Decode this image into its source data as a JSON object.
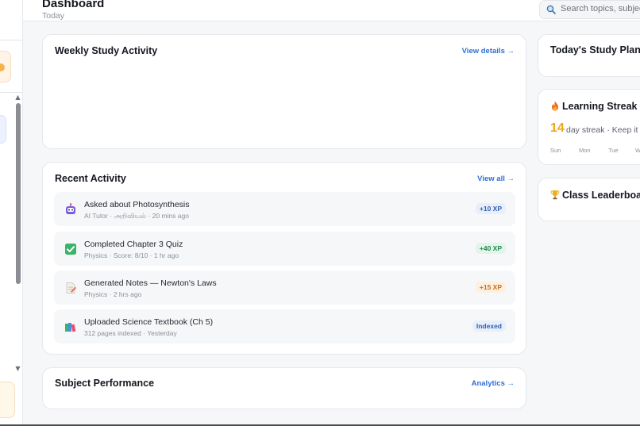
{
  "header": {
    "title": "Dashboard",
    "subtitle": "Today",
    "search_placeholder": "Search topics, subject"
  },
  "weekly": {
    "title": "Weekly Study Activity",
    "link": "View details →"
  },
  "recent": {
    "title": "Recent Activity",
    "link": "View all →",
    "items": [
      {
        "title": "Asked about Photosynthesis",
        "meta": "AI Tutor · அறிவியல் · 20 mins ago",
        "badge": "+10 XP",
        "icon": "robot-icon"
      },
      {
        "title": "Completed Chapter 3 Quiz",
        "meta": "Physics · Score: 8/10 · 1 hr ago",
        "badge": "+40 XP",
        "icon": "checkmark-icon"
      },
      {
        "title": "Generated Notes — Newton's Laws",
        "meta": "Physics · 2 hrs ago",
        "badge": "+15 XP",
        "icon": "memo-icon"
      },
      {
        "title": "Uploaded Science Textbook (Ch 5)",
        "meta": "312 pages indexed · Yesterday",
        "badge": "Indexed",
        "icon": "books-icon"
      }
    ]
  },
  "subject": {
    "title": "Subject Performance",
    "link": "Analytics →"
  },
  "plan": {
    "title": "Today's Study Plan"
  },
  "streak": {
    "title": "Learning Streak",
    "icon": "fire-icon",
    "count": "14",
    "text": "day streak · Keep it g",
    "days": [
      "Sun",
      "Mon",
      "Tue",
      "W"
    ]
  },
  "leaderboard": {
    "title": "Class Leaderboar",
    "icon": "trophy-icon"
  },
  "colors": {
    "accent": "#2f6fd6",
    "streak": "#f2a516",
    "xp_blue": "#2e5fb8",
    "xp_green": "#1f8a4c",
    "xp_orange": "#c9700e"
  }
}
